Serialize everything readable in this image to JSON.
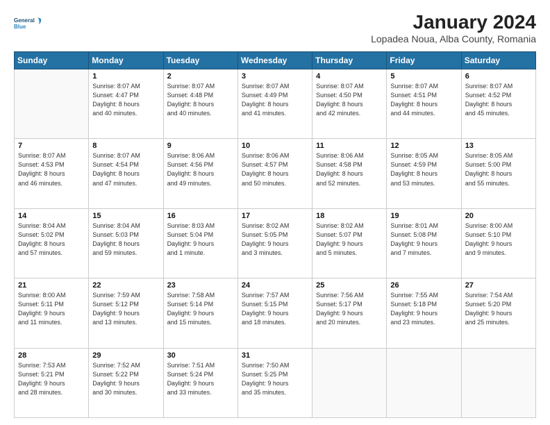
{
  "header": {
    "title": "January 2024",
    "subtitle": "Lopadea Noua, Alba County, Romania",
    "logo_line1": "General",
    "logo_line2": "Blue"
  },
  "weekdays": [
    "Sunday",
    "Monday",
    "Tuesday",
    "Wednesday",
    "Thursday",
    "Friday",
    "Saturday"
  ],
  "weeks": [
    [
      {
        "day": "",
        "info": ""
      },
      {
        "day": "1",
        "info": "Sunrise: 8:07 AM\nSunset: 4:47 PM\nDaylight: 8 hours\nand 40 minutes."
      },
      {
        "day": "2",
        "info": "Sunrise: 8:07 AM\nSunset: 4:48 PM\nDaylight: 8 hours\nand 40 minutes."
      },
      {
        "day": "3",
        "info": "Sunrise: 8:07 AM\nSunset: 4:49 PM\nDaylight: 8 hours\nand 41 minutes."
      },
      {
        "day": "4",
        "info": "Sunrise: 8:07 AM\nSunset: 4:50 PM\nDaylight: 8 hours\nand 42 minutes."
      },
      {
        "day": "5",
        "info": "Sunrise: 8:07 AM\nSunset: 4:51 PM\nDaylight: 8 hours\nand 44 minutes."
      },
      {
        "day": "6",
        "info": "Sunrise: 8:07 AM\nSunset: 4:52 PM\nDaylight: 8 hours\nand 45 minutes."
      }
    ],
    [
      {
        "day": "7",
        "info": "Sunrise: 8:07 AM\nSunset: 4:53 PM\nDaylight: 8 hours\nand 46 minutes."
      },
      {
        "day": "8",
        "info": "Sunrise: 8:07 AM\nSunset: 4:54 PM\nDaylight: 8 hours\nand 47 minutes."
      },
      {
        "day": "9",
        "info": "Sunrise: 8:06 AM\nSunset: 4:56 PM\nDaylight: 8 hours\nand 49 minutes."
      },
      {
        "day": "10",
        "info": "Sunrise: 8:06 AM\nSunset: 4:57 PM\nDaylight: 8 hours\nand 50 minutes."
      },
      {
        "day": "11",
        "info": "Sunrise: 8:06 AM\nSunset: 4:58 PM\nDaylight: 8 hours\nand 52 minutes."
      },
      {
        "day": "12",
        "info": "Sunrise: 8:05 AM\nSunset: 4:59 PM\nDaylight: 8 hours\nand 53 minutes."
      },
      {
        "day": "13",
        "info": "Sunrise: 8:05 AM\nSunset: 5:00 PM\nDaylight: 8 hours\nand 55 minutes."
      }
    ],
    [
      {
        "day": "14",
        "info": "Sunrise: 8:04 AM\nSunset: 5:02 PM\nDaylight: 8 hours\nand 57 minutes."
      },
      {
        "day": "15",
        "info": "Sunrise: 8:04 AM\nSunset: 5:03 PM\nDaylight: 8 hours\nand 59 minutes."
      },
      {
        "day": "16",
        "info": "Sunrise: 8:03 AM\nSunset: 5:04 PM\nDaylight: 9 hours\nand 1 minute."
      },
      {
        "day": "17",
        "info": "Sunrise: 8:02 AM\nSunset: 5:05 PM\nDaylight: 9 hours\nand 3 minutes."
      },
      {
        "day": "18",
        "info": "Sunrise: 8:02 AM\nSunset: 5:07 PM\nDaylight: 9 hours\nand 5 minutes."
      },
      {
        "day": "19",
        "info": "Sunrise: 8:01 AM\nSunset: 5:08 PM\nDaylight: 9 hours\nand 7 minutes."
      },
      {
        "day": "20",
        "info": "Sunrise: 8:00 AM\nSunset: 5:10 PM\nDaylight: 9 hours\nand 9 minutes."
      }
    ],
    [
      {
        "day": "21",
        "info": "Sunrise: 8:00 AM\nSunset: 5:11 PM\nDaylight: 9 hours\nand 11 minutes."
      },
      {
        "day": "22",
        "info": "Sunrise: 7:59 AM\nSunset: 5:12 PM\nDaylight: 9 hours\nand 13 minutes."
      },
      {
        "day": "23",
        "info": "Sunrise: 7:58 AM\nSunset: 5:14 PM\nDaylight: 9 hours\nand 15 minutes."
      },
      {
        "day": "24",
        "info": "Sunrise: 7:57 AM\nSunset: 5:15 PM\nDaylight: 9 hours\nand 18 minutes."
      },
      {
        "day": "25",
        "info": "Sunrise: 7:56 AM\nSunset: 5:17 PM\nDaylight: 9 hours\nand 20 minutes."
      },
      {
        "day": "26",
        "info": "Sunrise: 7:55 AM\nSunset: 5:18 PM\nDaylight: 9 hours\nand 23 minutes."
      },
      {
        "day": "27",
        "info": "Sunrise: 7:54 AM\nSunset: 5:20 PM\nDaylight: 9 hours\nand 25 minutes."
      }
    ],
    [
      {
        "day": "28",
        "info": "Sunrise: 7:53 AM\nSunset: 5:21 PM\nDaylight: 9 hours\nand 28 minutes."
      },
      {
        "day": "29",
        "info": "Sunrise: 7:52 AM\nSunset: 5:22 PM\nDaylight: 9 hours\nand 30 minutes."
      },
      {
        "day": "30",
        "info": "Sunrise: 7:51 AM\nSunset: 5:24 PM\nDaylight: 9 hours\nand 33 minutes."
      },
      {
        "day": "31",
        "info": "Sunrise: 7:50 AM\nSunset: 5:25 PM\nDaylight: 9 hours\nand 35 minutes."
      },
      {
        "day": "",
        "info": ""
      },
      {
        "day": "",
        "info": ""
      },
      {
        "day": "",
        "info": ""
      }
    ]
  ]
}
